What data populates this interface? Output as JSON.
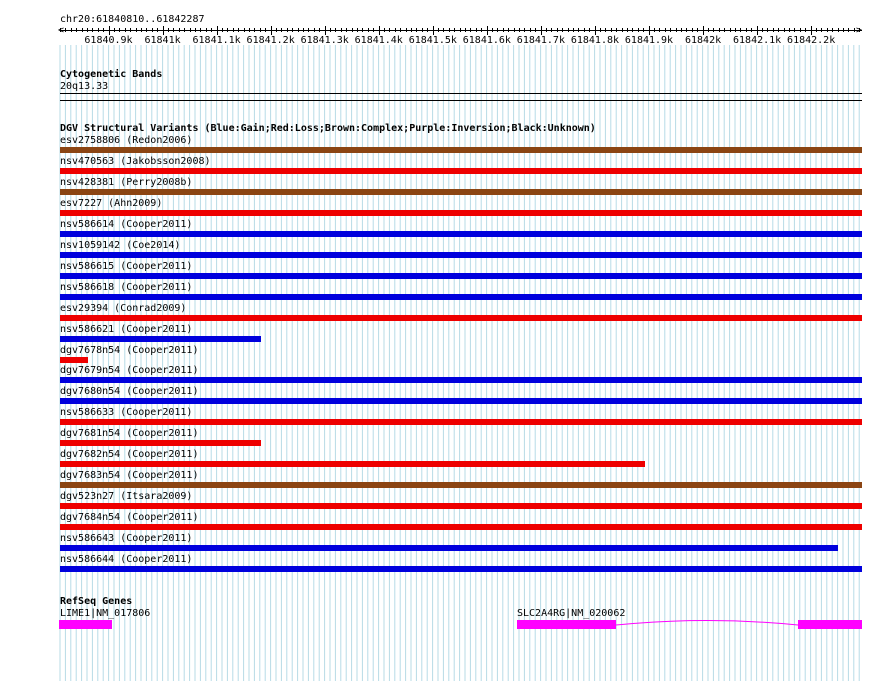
{
  "header": {
    "location": "chr20:61840810..61842287",
    "ruler_ticks": [
      "61840.9k",
      "61841k",
      "61841.1k",
      "61841.2k",
      "61841.3k",
      "61841.4k",
      "61841.5k",
      "61841.6k",
      "61841.7k",
      "61841.8k",
      "61841.9k",
      "61842k",
      "61842.1k",
      "61842.2k"
    ]
  },
  "cytoband": {
    "title": "Cytogenetic Bands",
    "band": "20q13.33"
  },
  "dgv": {
    "title": "DGV Structural Variants (Blue:Gain;Red:Loss;Brown:Complex;Purple:Inversion;Black:Unknown)",
    "colors": {
      "gain": "#0000dd",
      "loss": "#ee0000",
      "complex": "#8b4513",
      "inversion": "#800080",
      "unknown": "#000000"
    },
    "variants": [
      {
        "label": "esv2758806 (Redon2006)",
        "type": "complex",
        "start": 0.0,
        "end": 1.0
      },
      {
        "label": "nsv470563 (Jakobsson2008)",
        "type": "loss",
        "start": 0.0,
        "end": 1.0
      },
      {
        "label": "nsv428381 (Perry2008b)",
        "type": "complex",
        "start": 0.0,
        "end": 1.0
      },
      {
        "label": "esv7227 (Ahn2009)",
        "type": "loss",
        "start": 0.0,
        "end": 1.0
      },
      {
        "label": "nsv586614 (Cooper2011)",
        "type": "gain",
        "start": 0.0,
        "end": 1.0
      },
      {
        "label": "nsv1059142 (Coe2014)",
        "type": "gain",
        "start": 0.0,
        "end": 1.0
      },
      {
        "label": "nsv586615 (Cooper2011)",
        "type": "gain",
        "start": 0.0,
        "end": 1.0
      },
      {
        "label": "nsv586618 (Cooper2011)",
        "type": "gain",
        "start": 0.0,
        "end": 1.0
      },
      {
        "label": "esv29394 (Conrad2009)",
        "type": "loss",
        "start": 0.0,
        "end": 1.0
      },
      {
        "label": "nsv586621 (Cooper2011)",
        "type": "gain",
        "start": 0.0,
        "end": 0.25
      },
      {
        "label": "dgv7678n54 (Cooper2011)",
        "type": "loss",
        "start": 0.0,
        "end": 0.035
      },
      {
        "label": "dgv7679n54 (Cooper2011)",
        "type": "gain",
        "start": 0.0,
        "end": 1.0
      },
      {
        "label": "dgv7680n54 (Cooper2011)",
        "type": "gain",
        "start": 0.0,
        "end": 1.0
      },
      {
        "label": "nsv586633 (Cooper2011)",
        "type": "loss",
        "start": 0.0,
        "end": 1.0
      },
      {
        "label": "dgv7681n54 (Cooper2011)",
        "type": "loss",
        "start": 0.0,
        "end": 0.25
      },
      {
        "label": "dgv7682n54 (Cooper2011)",
        "type": "loss",
        "start": 0.0,
        "end": 0.729
      },
      {
        "label": "dgv7683n54 (Cooper2011)",
        "type": "complex",
        "start": 0.0,
        "end": 1.0
      },
      {
        "label": "dgv523n27 (Itsara2009)",
        "type": "loss",
        "start": 0.0,
        "end": 1.0
      },
      {
        "label": "dgv7684n54 (Cooper2011)",
        "type": "loss",
        "start": 0.0,
        "end": 1.0
      },
      {
        "label": "nsv586643 (Cooper2011)",
        "type": "gain",
        "start": 0.0,
        "end": 0.97
      },
      {
        "label": "nsv586644 (Cooper2011)",
        "type": "gain",
        "start": 0.0,
        "end": 1.0
      }
    ]
  },
  "refseq": {
    "title": "RefSeq Genes",
    "genes": [
      {
        "label": "LIME1|NM_017806"
      },
      {
        "label": "SLC2A4RG|NM_020062"
      }
    ]
  }
}
